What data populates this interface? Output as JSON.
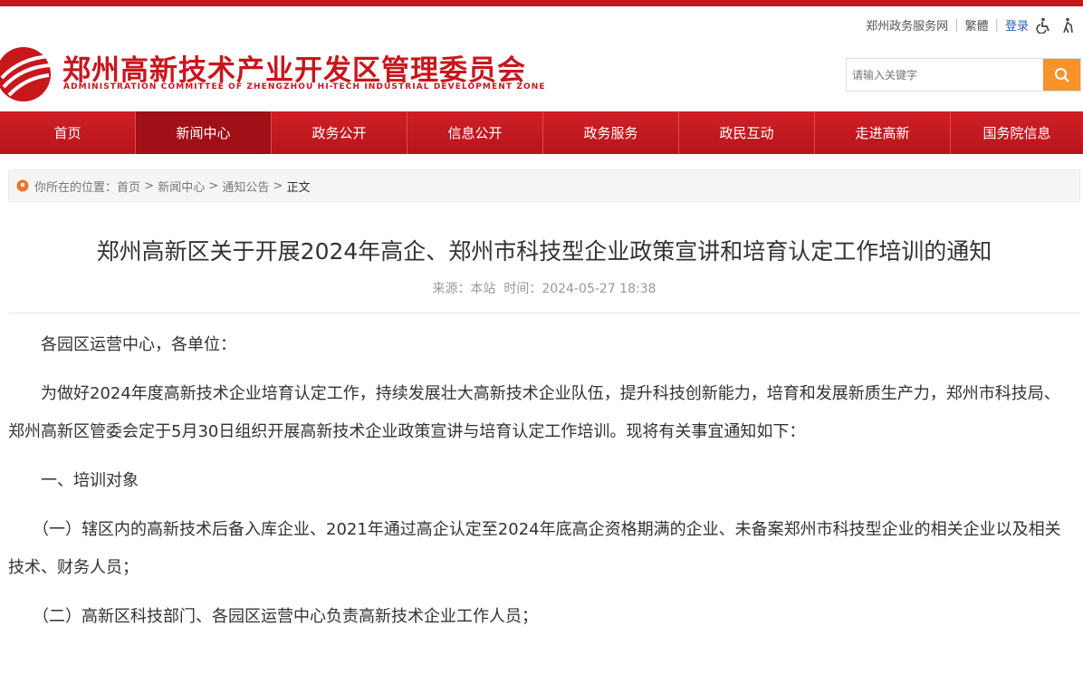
{
  "header": {
    "site_title": "郑州高新技术产业开发区管理委员会",
    "site_subtitle": "ADMINISTRATION COMMITTEE OF ZHENGZHOU HI-TECH INDUSTRIAL DEVELOPMENT ZONE",
    "top_links": {
      "gov_service": "郑州政务服务网",
      "traditional": "繁體",
      "login": "登录"
    },
    "search": {
      "placeholder": "请输入关键字"
    }
  },
  "nav": [
    "首页",
    "新闻中心",
    "政务公开",
    "信息公开",
    "政务服务",
    "政民互动",
    "走进高新",
    "国务院信息"
  ],
  "breadcrumb": {
    "prefix": "你所在的位置：",
    "items": [
      "首页",
      "新闻中心",
      "通知公告"
    ],
    "current": "正文"
  },
  "article": {
    "title": "郑州高新区关于开展2024年高企、郑州市科技型企业政策宣讲和培育认定工作培训的通知",
    "meta": "来源：本站  时间：2024-05-27 18:38",
    "paragraphs": [
      "　　各园区运营中心，各单位：",
      "　　为做好2024年度高新技术企业培育认定工作，持续发展壮大高新技术企业队伍，提升科技创新能力，培育和发展新质生产力，郑州市科技局、郑州高新区管委会定于5月30日组织开展高新技术企业政策宣讲与培育认定工作培训。现将有关事宜通知如下：",
      "　　一、培训对象",
      "　　（一）辖区内的高新技术后备入库企业、2021年通过高企认定至2024年底高企资格期满的企业、未备案郑州市科技型企业的相关企业以及相关技术、财务人员；",
      "　　（二）高新区科技部门、各园区运营中心负责高新技术企业工作人员；"
    ]
  },
  "colors": {
    "brand_red": "#c8161d",
    "search_orange": "#f8922b",
    "link_blue": "#2a63b5"
  }
}
